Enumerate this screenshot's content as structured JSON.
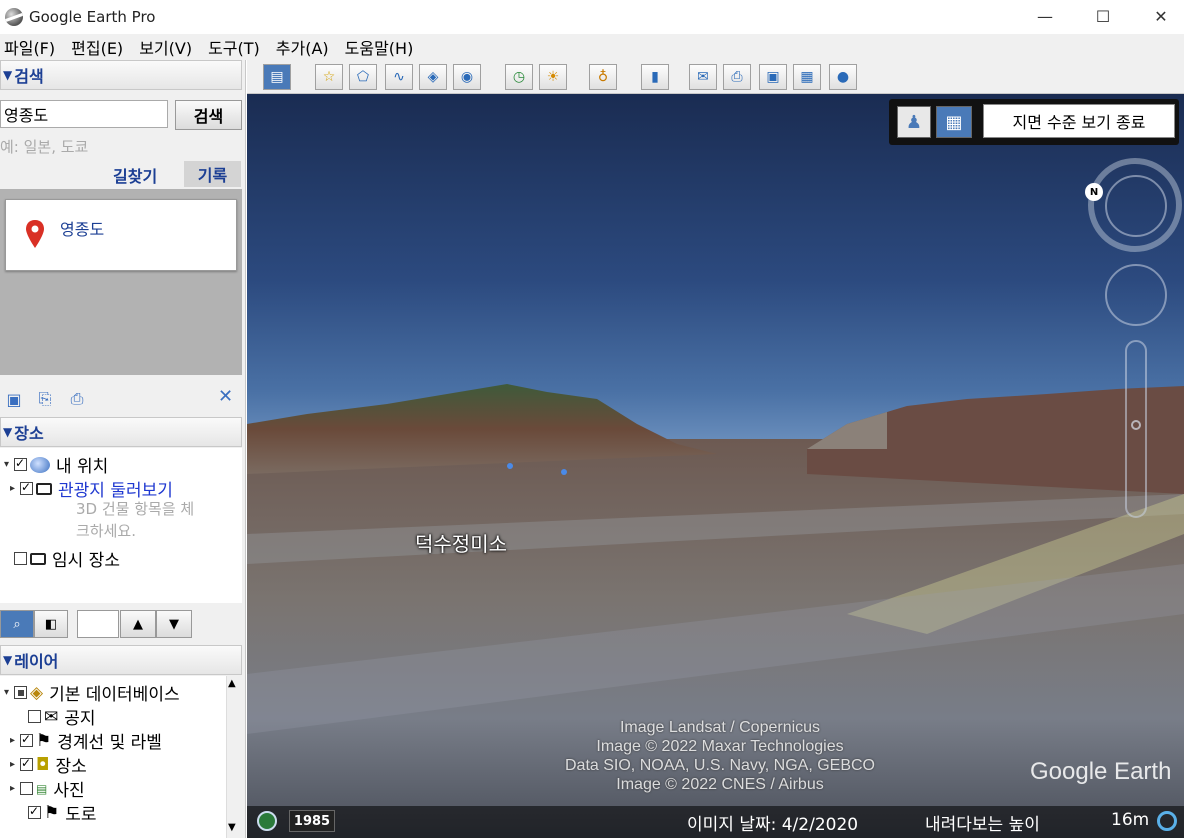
{
  "window": {
    "title": "Google Earth Pro",
    "minimize": "—",
    "maximize": "☐",
    "close": "✕"
  },
  "menu": [
    "파일(F)",
    "편집(E)",
    "보기(V)",
    "도구(T)",
    "추가(A)",
    "도움말(H)"
  ],
  "search": {
    "header": "검색",
    "input_value": "영종도",
    "button": "검색",
    "hint": "예: 일본, 도쿄",
    "directions": "길찾기",
    "history": "기록",
    "result": "영종도"
  },
  "places": {
    "header": "장소",
    "my_places": "내 위치",
    "sightseeing": "관광지 둘러보기",
    "hint_line1": "3D 건물 항목을 체",
    "hint_line2": "크하세요.",
    "temp_places": "임시 장소"
  },
  "layers": {
    "header": "레이어",
    "items": [
      "기본 데이터베이스",
      "공지",
      "경계선 및 라벨",
      "장소",
      "사진",
      "도로"
    ]
  },
  "map": {
    "exit_ground_view": "지면 수준 보기 종료",
    "compass_n": "N",
    "place_label": "덕수정미소",
    "attributions": [
      "Image Landsat / Copernicus",
      "Image © 2022 Maxar Technologies",
      "Data SIO, NOAA, U.S. Navy, NGA, GEBCO",
      "Image © 2022 CNES / Airbus"
    ],
    "logo": "Google Earth"
  },
  "status": {
    "year": "1985",
    "imagery_date": "이미지 날짜: 4/2/2020",
    "eye_alt_label": "내려다보는 높이",
    "eye_alt_value": "16m"
  },
  "colors": {
    "accent": "#1c3f94",
    "pin": "#d93025",
    "building_btn": "#4a7ab8"
  }
}
